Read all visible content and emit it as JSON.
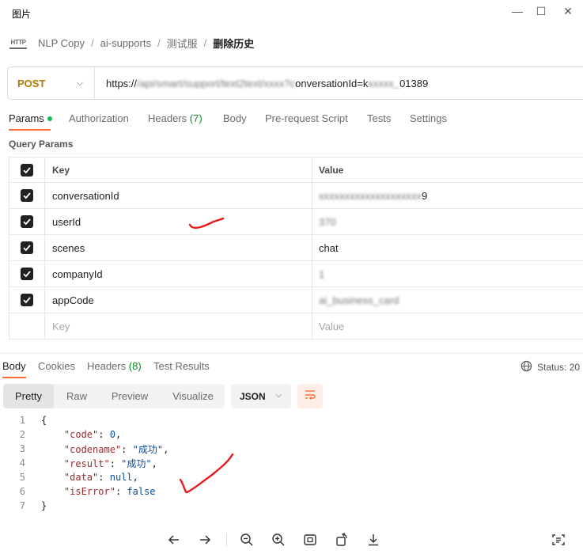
{
  "window": {
    "title": "图片",
    "minimize": "—",
    "maximize": "☐",
    "close": "✕"
  },
  "breadcrumb": {
    "items": [
      "NLP Copy",
      "ai-supports",
      "测试服"
    ],
    "current": "删除历史",
    "separator": "/"
  },
  "request": {
    "method": "POST",
    "url": "https://[redacted]/api/smart/support/text2text/[redacted]?conversationId=[redacted]01389"
  },
  "url_display": {
    "start": "https://",
    "end": "onversationId=k",
    "tail": "01389"
  },
  "tabs": [
    {
      "label": "Params",
      "count": ""
    },
    {
      "label": "Authorization",
      "count": ""
    },
    {
      "label": "Headers",
      "count": "(7)"
    },
    {
      "label": "Body",
      "count": ""
    },
    {
      "label": "Pre-request Script",
      "count": ""
    },
    {
      "label": "Tests",
      "count": ""
    },
    {
      "label": "Settings",
      "count": ""
    }
  ],
  "query_params": {
    "label": "Query Params",
    "header": {
      "key": "Key",
      "value": "Value"
    },
    "rows": [
      {
        "key": "conversationId",
        "value": "9"
      },
      {
        "key": "userId",
        "value": "370"
      },
      {
        "key": "scenes",
        "value": "chat"
      },
      {
        "key": "companyId",
        "value": "1"
      },
      {
        "key": "appCode",
        "value": "ai_business_card"
      }
    ],
    "placeholder": {
      "key": "Key",
      "value": "Value"
    }
  },
  "response": {
    "tabs": [
      {
        "label": "Body",
        "count": ""
      },
      {
        "label": "Cookies",
        "count": ""
      },
      {
        "label": "Headers",
        "count": "(8)"
      },
      {
        "label": "Test Results",
        "count": ""
      }
    ],
    "status": "Status: 20",
    "view_modes": [
      "Pretty",
      "Raw",
      "Preview",
      "Visualize"
    ],
    "format": "JSON",
    "body_lines": [
      {
        "n": "1",
        "text": "{"
      },
      {
        "n": "2",
        "key": "\"code\"",
        "value": "0",
        "suffix": ","
      },
      {
        "n": "3",
        "key": "\"codename\"",
        "value": "\"成功\"",
        "suffix": ","
      },
      {
        "n": "4",
        "key": "\"result\"",
        "value": "\"成功\"",
        "suffix": ","
      },
      {
        "n": "5",
        "key": "\"data\"",
        "value": "null",
        "suffix": ","
      },
      {
        "n": "6",
        "key": "\"isError\"",
        "value": "false",
        "suffix": ""
      },
      {
        "n": "7",
        "text": "}"
      }
    ]
  },
  "colors": {
    "accent": "#ff6c37",
    "method": "#ad7a03",
    "active_dot": "#0cbb52",
    "annotation": "#e8191d"
  }
}
